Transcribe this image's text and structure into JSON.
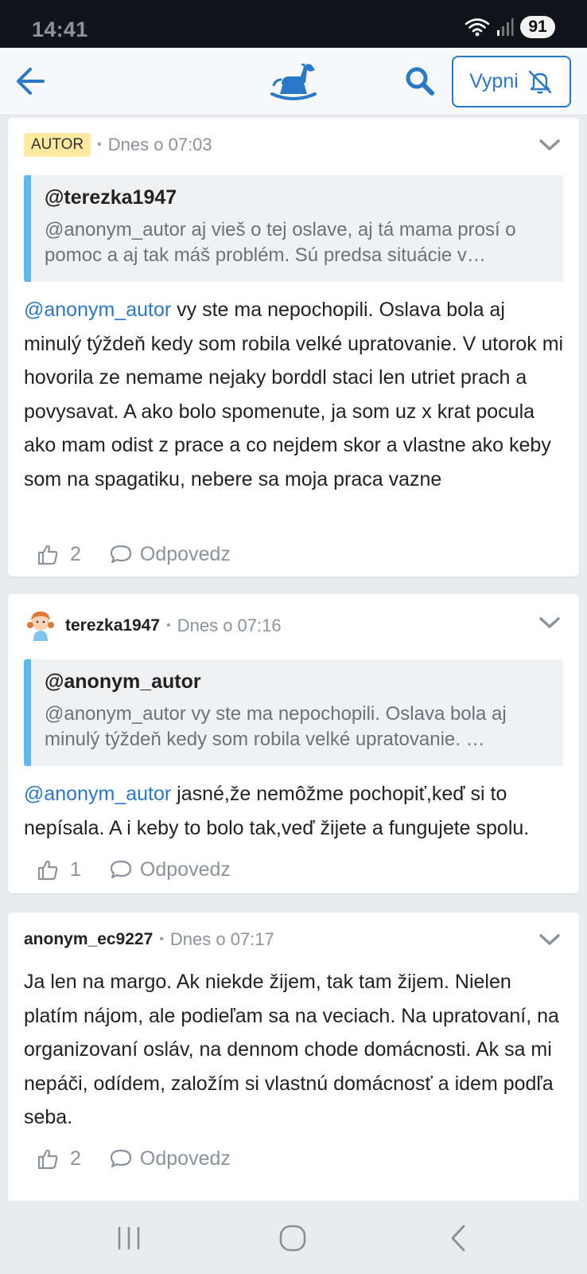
{
  "status_bar": {
    "time": "14:41",
    "battery": "91",
    "icons": [
      "wifi-icon",
      "signal-icon",
      "battery-icon"
    ]
  },
  "app_bar": {
    "vypni_label": "Vypni",
    "icons": [
      "back-arrow-icon",
      "rocking-horse-logo",
      "search-icon",
      "bell-off-icon"
    ]
  },
  "colors": {
    "accent": "#2a78c8",
    "quote_bar": "#5ab8f5",
    "badge": "#fde9a0"
  },
  "comments": [
    {
      "badge": "AUTOR",
      "time": "Dnes o 07:03",
      "quote": {
        "user": "@terezka1947",
        "text": "@anonym_autor aj vieš o tej oslave, aj tá mama prosí o pomoc a aj tak máš problém. Sú predsa situácie v…"
      },
      "mention": "@anonym_autor",
      "text": " vy ste ma nepochopili. Oslava bola aj minulý týždeň kedy som robila velké upratovanie. V utorok mi hovorila ze nemame nejaky borddl staci len utriet prach a povysavat. A ako bolo spomenute, ja som uz x krat pocula ako mam odist z prace a co nejdem skor a vlastne ako keby som na spagatiku, nebere sa moja praca vazne",
      "likes": "2",
      "reply_label": "Odpovedz"
    },
    {
      "user": "terezka1947",
      "time": "Dnes o 07:16",
      "quote": {
        "user": "@anonym_autor",
        "text": "@anonym_autor vy ste ma nepochopili. Oslava bola aj minulý týždeň kedy som robila velké upratovanie. …"
      },
      "mention": "@anonym_autor",
      "text": " jasné,že nemôžme pochopiť,keď si to nepísala. A i keby to bolo tak,veď žijete a fungujete spolu.",
      "likes": "1",
      "reply_label": "Odpovedz"
    },
    {
      "user": "anonym_ec9227",
      "time": "Dnes o 07:17",
      "text": "Ja len na margo. Ak niekde žijem, tak tam žijem. Nielen platím nájom, ale podieľam sa na veciach. Na upratovaní, na organizovaní osláv, na dennom chode domácnosti. Ak sa mi nepáči, odídem, založím si vlastnú domácnosť a idem podľa seba.",
      "likes": "2",
      "reply_label": "Odpovedz"
    }
  ]
}
